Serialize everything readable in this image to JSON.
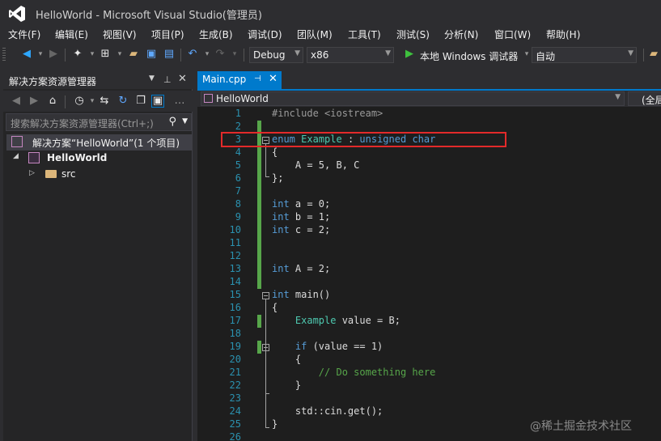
{
  "window": {
    "title": "HelloWorld - Microsoft Visual Studio(管理员)",
    "logo": "visual-studio-logo"
  },
  "menu": [
    "文件(F)",
    "编辑(E)",
    "视图(V)",
    "项目(P)",
    "生成(B)",
    "调试(D)",
    "团队(M)",
    "工具(T)",
    "测试(S)",
    "分析(N)",
    "窗口(W)",
    "帮助(H)"
  ],
  "toolbar": {
    "config": "Debug",
    "platform": "x86",
    "run_label": "本地 Windows 调试器",
    "run_mode": "自动"
  },
  "solution_explorer": {
    "title": "解决方案资源管理器",
    "search_placeholder": "搜索解决方案资源管理器(Ctrl+;)",
    "solution_label": "解决方案“HelloWorld”(1 个项目)",
    "project_label": "HelloWorld",
    "folder_label": "src"
  },
  "editor": {
    "tab_label": "Main.cpp",
    "nav_scope": "HelloWorld",
    "nav_member": "(全局"
  },
  "code_lines": [
    {
      "n": "1",
      "t": "#include <iostream>"
    },
    {
      "n": "2",
      "t": ""
    },
    {
      "n": "3",
      "t": "enum Example : unsigned char"
    },
    {
      "n": "4",
      "t": "{"
    },
    {
      "n": "5",
      "t": "    A = 5, B, C"
    },
    {
      "n": "6",
      "t": "};"
    },
    {
      "n": "7",
      "t": ""
    },
    {
      "n": "8",
      "t": "int a = 0;"
    },
    {
      "n": "9",
      "t": "int b = 1;"
    },
    {
      "n": "10",
      "t": "int c = 2;"
    },
    {
      "n": "11",
      "t": ""
    },
    {
      "n": "12",
      "t": ""
    },
    {
      "n": "13",
      "t": "int A = 2;"
    },
    {
      "n": "14",
      "t": ""
    },
    {
      "n": "15",
      "t": "int main()"
    },
    {
      "n": "16",
      "t": "{"
    },
    {
      "n": "17",
      "t": "    Example value = B;"
    },
    {
      "n": "18",
      "t": ""
    },
    {
      "n": "19",
      "t": "    if (value == 1)"
    },
    {
      "n": "20",
      "t": "    {"
    },
    {
      "n": "21",
      "t": "        // Do something here"
    },
    {
      "n": "22",
      "t": "    }"
    },
    {
      "n": "23",
      "t": ""
    },
    {
      "n": "24",
      "t": "    std::cin.get();"
    },
    {
      "n": "25",
      "t": "}"
    },
    {
      "n": "26",
      "t": ""
    }
  ],
  "watermark": "@稀土掘金技术社区",
  "colors": {
    "accent": "#007acc",
    "highlight_box": "#e32a2a",
    "keyword": "#569cd6",
    "type": "#4ec9b0",
    "comment": "#57a64a"
  }
}
